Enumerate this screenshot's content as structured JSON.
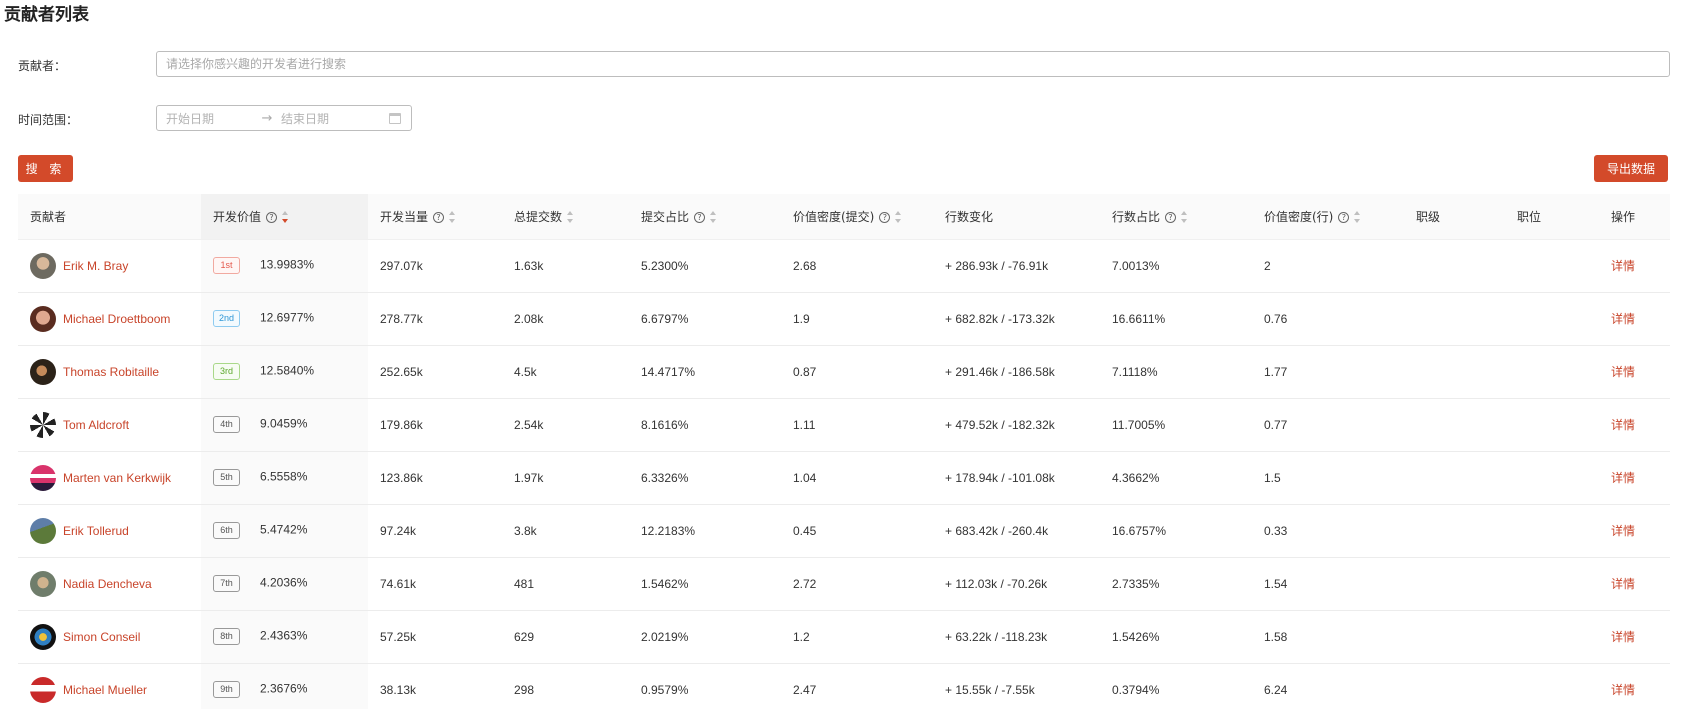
{
  "page": {
    "title": "贡献者列表"
  },
  "form": {
    "contributor_label": "贡献者：",
    "contributor_placeholder": "请选择你感兴趣的开发者进行搜索",
    "time_label": "时间范围：",
    "start_placeholder": "开始日期",
    "range_separator": "→",
    "end_placeholder": "结束日期",
    "search_button": "搜 索",
    "export_button": "导出数据"
  },
  "colors": {
    "accent": "#d34a2a",
    "link": "#c8442a"
  },
  "table": {
    "columns": [
      {
        "label": "贡献者"
      },
      {
        "label": "开发价值"
      },
      {
        "label": "开发当量"
      },
      {
        "label": "总提交数"
      },
      {
        "label": "提交占比"
      },
      {
        "label": "价值密度(提交)"
      },
      {
        "label": "行数变化"
      },
      {
        "label": "行数占比"
      },
      {
        "label": "价值密度(行)"
      },
      {
        "label": "职级"
      },
      {
        "label": "职位"
      },
      {
        "label": "操作"
      }
    ],
    "help_glyph": "?",
    "detail_label": "详情",
    "rows": [
      {
        "name": "Erik M. Bray",
        "rank": "1st",
        "value": "13.9983%",
        "equivalent": "297.07k",
        "commits": "1.63k",
        "commit_share": "5.2300%",
        "density_commit": "2.68",
        "line_change": "+ 286.93k / -76.91k",
        "line_share": "7.0013%",
        "density_line": "2",
        "level": "",
        "position": ""
      },
      {
        "name": "Michael Droettboom",
        "rank": "2nd",
        "value": "12.6977%",
        "equivalent": "278.77k",
        "commits": "2.08k",
        "commit_share": "6.6797%",
        "density_commit": "1.9",
        "line_change": "+ 682.82k / -173.32k",
        "line_share": "16.6611%",
        "density_line": "0.76",
        "level": "",
        "position": ""
      },
      {
        "name": "Thomas Robitaille",
        "rank": "3rd",
        "value": "12.5840%",
        "equivalent": "252.65k",
        "commits": "4.5k",
        "commit_share": "14.4717%",
        "density_commit": "0.87",
        "line_change": "+ 291.46k / -186.58k",
        "line_share": "7.1118%",
        "density_line": "1.77",
        "level": "",
        "position": ""
      },
      {
        "name": "Tom Aldcroft",
        "rank": "4th",
        "value": "9.0459%",
        "equivalent": "179.86k",
        "commits": "2.54k",
        "commit_share": "8.1616%",
        "density_commit": "1.11",
        "line_change": "+ 479.52k / -182.32k",
        "line_share": "11.7005%",
        "density_line": "0.77",
        "level": "",
        "position": ""
      },
      {
        "name": "Marten van Kerkwijk",
        "rank": "5th",
        "value": "6.5558%",
        "equivalent": "123.86k",
        "commits": "1.97k",
        "commit_share": "6.3326%",
        "density_commit": "1.04",
        "line_change": "+ 178.94k / -101.08k",
        "line_share": "4.3662%",
        "density_line": "1.5",
        "level": "",
        "position": ""
      },
      {
        "name": "Erik Tollerud",
        "rank": "6th",
        "value": "5.4742%",
        "equivalent": "97.24k",
        "commits": "3.8k",
        "commit_share": "12.2183%",
        "density_commit": "0.45",
        "line_change": "+ 683.42k / -260.4k",
        "line_share": "16.6757%",
        "density_line": "0.33",
        "level": "",
        "position": ""
      },
      {
        "name": "Nadia Dencheva",
        "rank": "7th",
        "value": "4.2036%",
        "equivalent": "74.61k",
        "commits": "481",
        "commit_share": "1.5462%",
        "density_commit": "2.72",
        "line_change": "+ 112.03k / -70.26k",
        "line_share": "2.7335%",
        "density_line": "1.54",
        "level": "",
        "position": ""
      },
      {
        "name": "Simon Conseil",
        "rank": "8th",
        "value": "2.4363%",
        "equivalent": "57.25k",
        "commits": "629",
        "commit_share": "2.0219%",
        "density_commit": "1.2",
        "line_change": "+ 63.22k / -118.23k",
        "line_share": "1.5426%",
        "density_line": "1.58",
        "level": "",
        "position": ""
      },
      {
        "name": "Michael Mueller",
        "rank": "9th",
        "value": "2.3676%",
        "equivalent": "38.13k",
        "commits": "298",
        "commit_share": "0.9579%",
        "density_commit": "2.47",
        "line_change": "+ 15.55k / -7.55k",
        "line_share": "0.3794%",
        "density_line": "6.24",
        "level": "",
        "position": ""
      }
    ]
  }
}
